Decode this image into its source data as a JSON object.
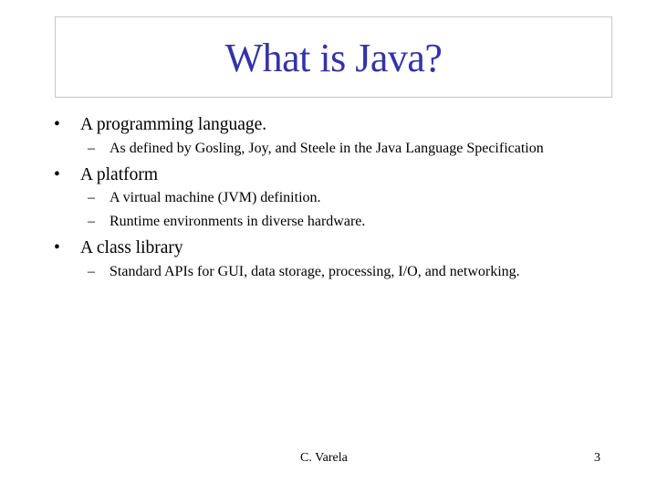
{
  "slide": {
    "title": "What is Java?",
    "title_color": "#3333aa",
    "bullets": [
      {
        "text": "A programming language.",
        "subitems": [
          "As defined by Gosling, Joy, and Steele in the Java Language Specification"
        ]
      },
      {
        "text": "A platform",
        "subitems": [
          "A virtual machine (JVM) definition.",
          "Runtime environments in diverse hardware."
        ]
      },
      {
        "text": "A class library",
        "subitems": [
          "Standard APIs for GUI, data storage, processing, I/O, and networking."
        ]
      }
    ],
    "bullet_glyph": "•",
    "dash_glyph": "–"
  },
  "footer": {
    "author": "C. Varela",
    "page_number": "3"
  }
}
